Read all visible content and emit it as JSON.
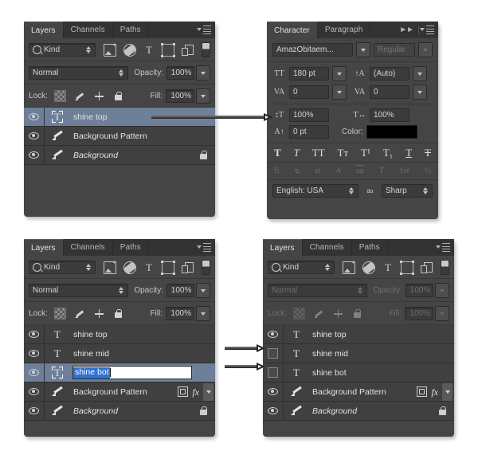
{
  "panels": {
    "layers_top_left": {
      "tabs": [
        {
          "label": "Layers",
          "active": true
        },
        {
          "label": "Channels",
          "active": false
        },
        {
          "label": "Paths",
          "active": false
        }
      ],
      "filter_kind": "Kind",
      "filter_icons": [
        "pixel-layer-filter-icon",
        "adjustment-layer-filter-icon",
        "type-layer-filter-icon",
        "shape-layer-filter-icon",
        "smart-object-filter-icon"
      ],
      "blend_mode": "Normal",
      "opacity_label": "Opacity:",
      "opacity_value": "100%",
      "lock_label": "Lock:",
      "lock_icons": [
        "lock-transparent-pixels-icon",
        "lock-image-pixels-icon",
        "lock-position-icon",
        "lock-all-icon"
      ],
      "fill_label": "Fill:",
      "fill_value": "100%",
      "disabled": false,
      "layers": [
        {
          "name": "shine top",
          "type": "text",
          "visible": true,
          "selected": true,
          "thumb_focus": true,
          "locked": false,
          "italic": false,
          "fx": false
        },
        {
          "name": "Background Pattern",
          "type": "brush",
          "visible": true,
          "selected": false,
          "thumb_focus": false,
          "locked": false,
          "italic": false,
          "fx": false
        },
        {
          "name": "Background",
          "type": "brush",
          "visible": true,
          "selected": false,
          "thumb_focus": false,
          "locked": true,
          "italic": true,
          "fx": false
        }
      ]
    },
    "character": {
      "tabs": [
        {
          "label": "Character",
          "active": true
        },
        {
          "label": "Paragraph",
          "active": false
        }
      ],
      "font_family": "AmazObitaem...",
      "font_style": "Regular",
      "font_size_icon": "font-size-icon",
      "font_size": "180 pt",
      "leading_icon": "leading-icon",
      "leading": "(Auto)",
      "kerning_icon": "kerning-icon",
      "kerning": "0",
      "tracking_icon": "tracking-icon",
      "tracking": "0",
      "vertical_scale_icon": "vertical-scale-icon",
      "vertical_scale": "100%",
      "horizontal_scale_icon": "horizontal-scale-icon",
      "horizontal_scale": "100%",
      "baseline_shift_icon": "baseline-shift-icon",
      "baseline_shift": "0 pt",
      "color_label": "Color:",
      "color_value": "#000000",
      "style_buttons_row1": [
        "T",
        "T",
        "TT",
        "Tт",
        "T¹",
        "T₁",
        "T",
        "T"
      ],
      "style_buttons_row2": [
        "fi",
        "ᴓ",
        "st",
        "A",
        "aa",
        "T",
        "1st",
        "½"
      ],
      "language": "English: USA",
      "aa_icon": "anti-alias-icon",
      "anti_aliasing": "Sharp"
    },
    "layers_bottom_left": {
      "tabs": [
        {
          "label": "Layers",
          "active": true
        },
        {
          "label": "Channels",
          "active": false
        },
        {
          "label": "Paths",
          "active": false
        }
      ],
      "filter_kind": "Kind",
      "blend_mode": "Normal",
      "opacity_label": "Opacity:",
      "opacity_value": "100%",
      "lock_label": "Lock:",
      "fill_label": "Fill:",
      "fill_value": "100%",
      "disabled": false,
      "layers": [
        {
          "name": "shine top",
          "type": "text",
          "visible": true,
          "selected": false,
          "thumb_focus": false,
          "locked": false,
          "italic": false,
          "fx": false
        },
        {
          "name": "shine mid",
          "type": "text",
          "visible": true,
          "selected": false,
          "thumb_focus": false,
          "locked": false,
          "italic": false,
          "fx": false
        },
        {
          "name": "shine bot",
          "type": "text",
          "visible": true,
          "selected": true,
          "thumb_focus": true,
          "locked": false,
          "italic": false,
          "fx": false,
          "renaming": true
        },
        {
          "name": "Background Pattern",
          "type": "brush",
          "visible": true,
          "selected": false,
          "thumb_focus": false,
          "locked": false,
          "italic": false,
          "fx": true
        },
        {
          "name": "Background",
          "type": "brush",
          "visible": true,
          "selected": false,
          "thumb_focus": false,
          "locked": true,
          "italic": true,
          "fx": false
        }
      ]
    },
    "layers_bottom_right": {
      "tabs": [
        {
          "label": "Layers",
          "active": true
        },
        {
          "label": "Channels",
          "active": false
        },
        {
          "label": "Paths",
          "active": false
        }
      ],
      "filter_kind": "Kind",
      "blend_mode": "Normal",
      "opacity_label": "Opacity:",
      "opacity_value": "100%",
      "lock_label": "Lock:",
      "fill_label": "Fill:",
      "fill_value": "100%",
      "disabled": true,
      "layers": [
        {
          "name": "shine top",
          "type": "text",
          "visible": true,
          "selected": false,
          "thumb_focus": false,
          "locked": false,
          "italic": false,
          "fx": false
        },
        {
          "name": "shine mid",
          "type": "text",
          "visible": false,
          "selected": false,
          "thumb_focus": false,
          "locked": false,
          "italic": false,
          "fx": false
        },
        {
          "name": "shine bot",
          "type": "text",
          "visible": false,
          "selected": false,
          "thumb_focus": false,
          "locked": false,
          "italic": false,
          "fx": false
        },
        {
          "name": "Background Pattern",
          "type": "brush",
          "visible": true,
          "selected": false,
          "thumb_focus": false,
          "locked": false,
          "italic": false,
          "fx": true
        },
        {
          "name": "Background",
          "type": "brush",
          "visible": true,
          "selected": false,
          "thumb_focus": false,
          "locked": true,
          "italic": true,
          "fx": false
        }
      ]
    }
  },
  "annotations": {
    "arrows": [
      {
        "name": "arrow-shine-top-to-character",
        "from": "shine top layer",
        "to": "Character panel"
      },
      {
        "name": "arrow-to-shine-mid-visibility",
        "from": "left",
        "to": "shine mid visibility toggle"
      },
      {
        "name": "arrow-to-shine-bot-visibility",
        "from": "left",
        "to": "shine bot visibility toggle"
      }
    ]
  },
  "colors": {
    "panel_bg": "#454545",
    "tab_bg": "#333333",
    "row_bg": "#404040",
    "selection": "#6e7f99",
    "text": "#e2e2e2",
    "rename_selection": "#2f72d0"
  }
}
